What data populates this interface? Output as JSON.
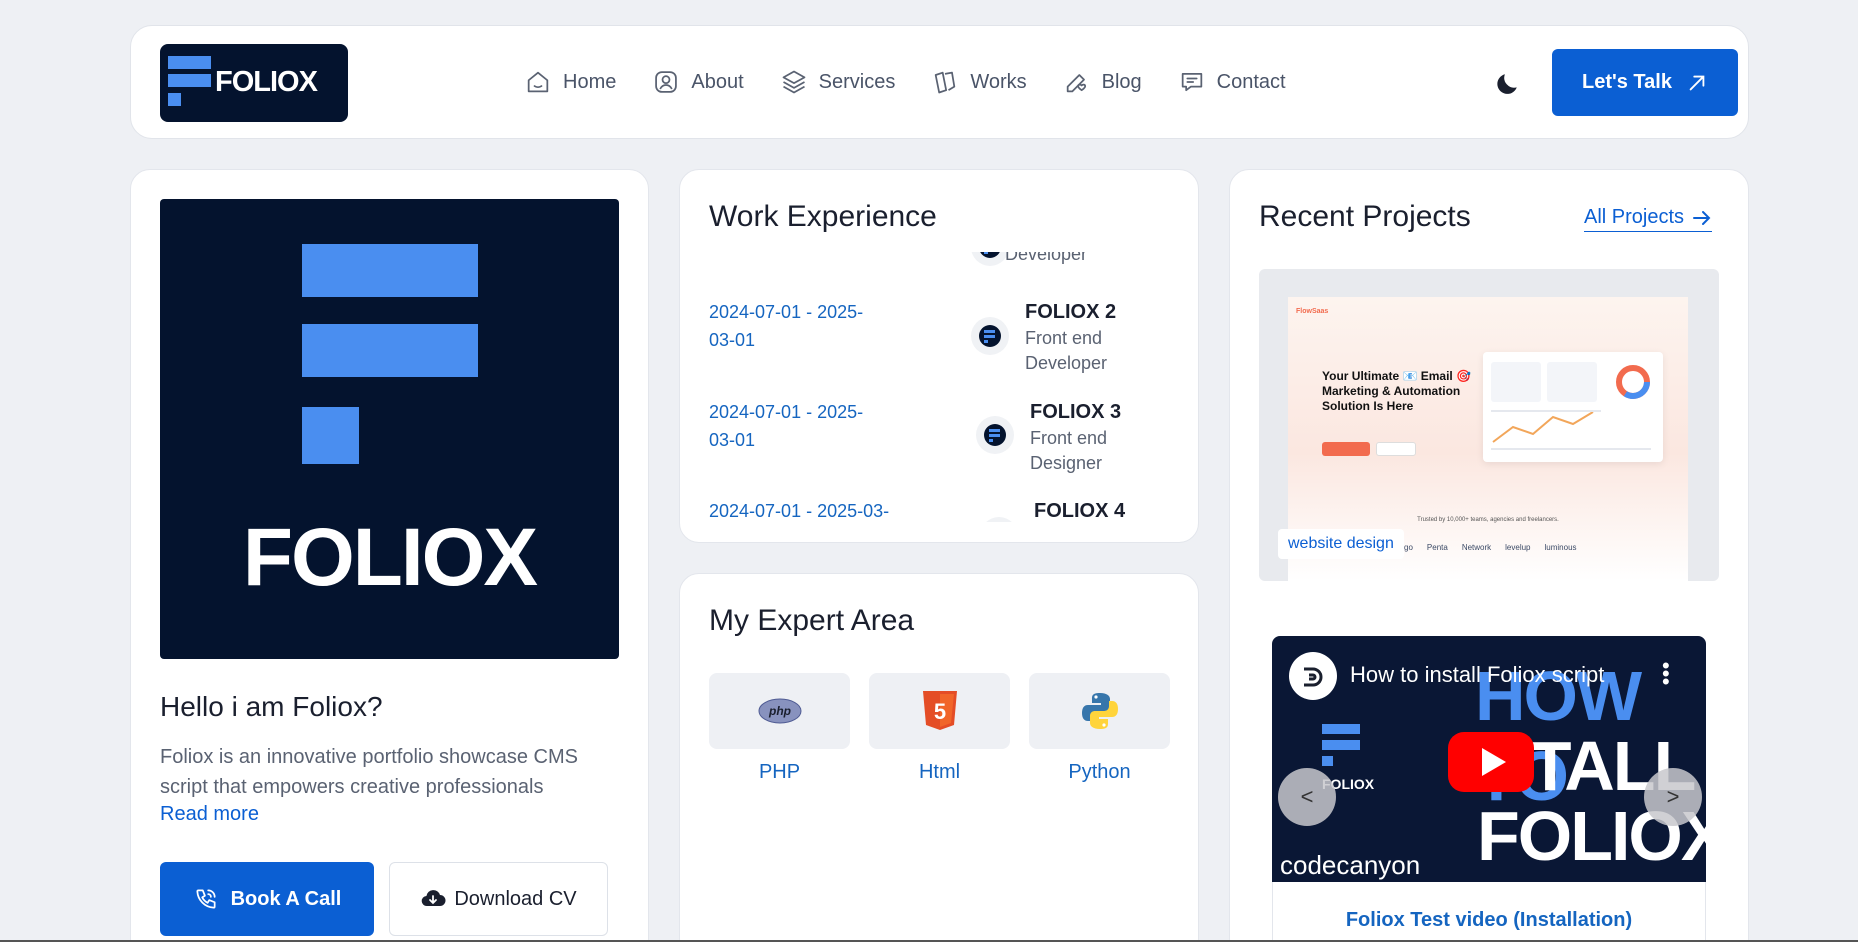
{
  "header": {
    "logo_text": "FOLIOX",
    "nav": [
      {
        "label": "Home",
        "icon": "home-icon"
      },
      {
        "label": "About",
        "icon": "user-icon"
      },
      {
        "label": "Services",
        "icon": "layers-icon"
      },
      {
        "label": "Works",
        "icon": "cards-icon"
      },
      {
        "label": "Blog",
        "icon": "pen-heart-icon"
      },
      {
        "label": "Contact",
        "icon": "chat-icon"
      }
    ],
    "cta_label": "Let's Talk"
  },
  "profile": {
    "hero_text": "FOLIOX",
    "title": "Hello i am Foliox?",
    "description": "Foliox is an innovative portfolio showcase CMS script that empowers creative professionals",
    "read_more": "Read more",
    "book_label": "Book A Call",
    "cv_label": "Download CV"
  },
  "work": {
    "title": "Work Experience",
    "items": [
      {
        "date": "",
        "company": "",
        "role": "Developer"
      },
      {
        "date": "2024-07-01 - 2025-03-01",
        "company": "FOLIOX 2",
        "role": "Front end Developer"
      },
      {
        "date": "2024-07-01 - 2025-03-01",
        "company": "FOLIOX 3",
        "role": "Front end Designer"
      },
      {
        "date": "2024-07-01 - 2025-03-",
        "company": "FOLIOX 4",
        "role": ""
      }
    ]
  },
  "expert": {
    "title": "My Expert Area",
    "skills": [
      {
        "label": "PHP",
        "icon": "php-icon"
      },
      {
        "label": "Html",
        "icon": "html5-icon"
      },
      {
        "label": "Python",
        "icon": "python-icon"
      }
    ]
  },
  "projects": {
    "title": "Recent Projects",
    "all_label": "All Projects",
    "project_tag": "website design",
    "mock": {
      "brand": "FlowSaas",
      "headline": "Your Ultimate 📧 Email 🎯Marketing & Automation Solution Is Here",
      "trust": "Trusted by 10,000+ teams, agencies and freelancers.",
      "logos": [
        "Vertigo",
        "Penta",
        "Network",
        "levelup",
        "luminous"
      ]
    },
    "video": {
      "title": "How to install Foliox script",
      "big1": "HOW TO",
      "big2": "STALL",
      "big3": "FOLIOX",
      "logo": "FOLIOX",
      "brand": "codecanyon",
      "caption": "Foliox Test video (Installation)"
    }
  },
  "colors": {
    "accent": "#0b5fd3",
    "dark": "#04132e",
    "logo_blue": "#4a8ef0"
  }
}
